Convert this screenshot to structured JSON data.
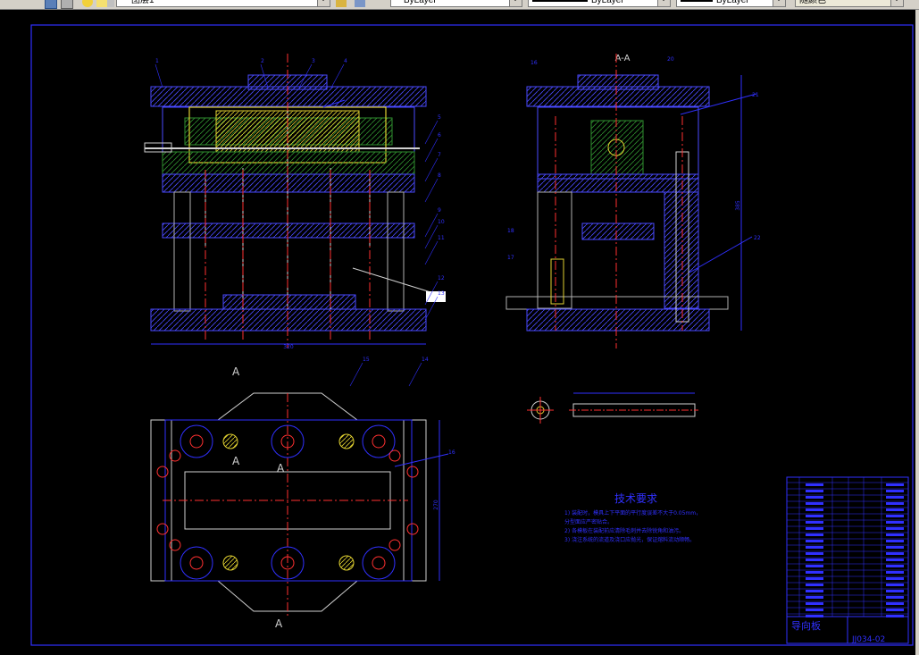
{
  "toolbar": {
    "layer_combo": "图层1",
    "color_combo": "ByLayer",
    "linetype_combo": "ByLayer",
    "lineweight_combo": "ByLayer",
    "plotstyle_combo": "随颜色"
  },
  "drawing": {
    "section_label_top": "A-A",
    "section_mark_left_top": "A",
    "section_mark_left_bottom": "A",
    "section_mark_mid": "A",
    "section_mark_bottom": "A",
    "front_width_dim": "320",
    "side_height_dim": "385",
    "plan_height_dim": "270",
    "leaders_front": [
      "1",
      "2",
      "3",
      "4",
      "5",
      "6",
      "7",
      "8",
      "9",
      "10",
      "11",
      "12",
      "13",
      "14",
      "15"
    ],
    "leaders_side": [
      "16",
      "20",
      "21",
      "18",
      "17",
      "22"
    ],
    "plan_leader": "16",
    "tech_title": "技术要求",
    "tech_lines": [
      "1) 装配时，模具上下平面的平行度误差不大于0.05mm，",
      "    分型面应严密贴合。",
      "2) 各模板在装配前应清除毛刺并去除锐角和油污。",
      "3) 浇注系统的流道及浇口应抛光，保证熔料流动顺畅。"
    ],
    "title_block_name": "导向板",
    "title_block_number": "JJ034-02"
  }
}
